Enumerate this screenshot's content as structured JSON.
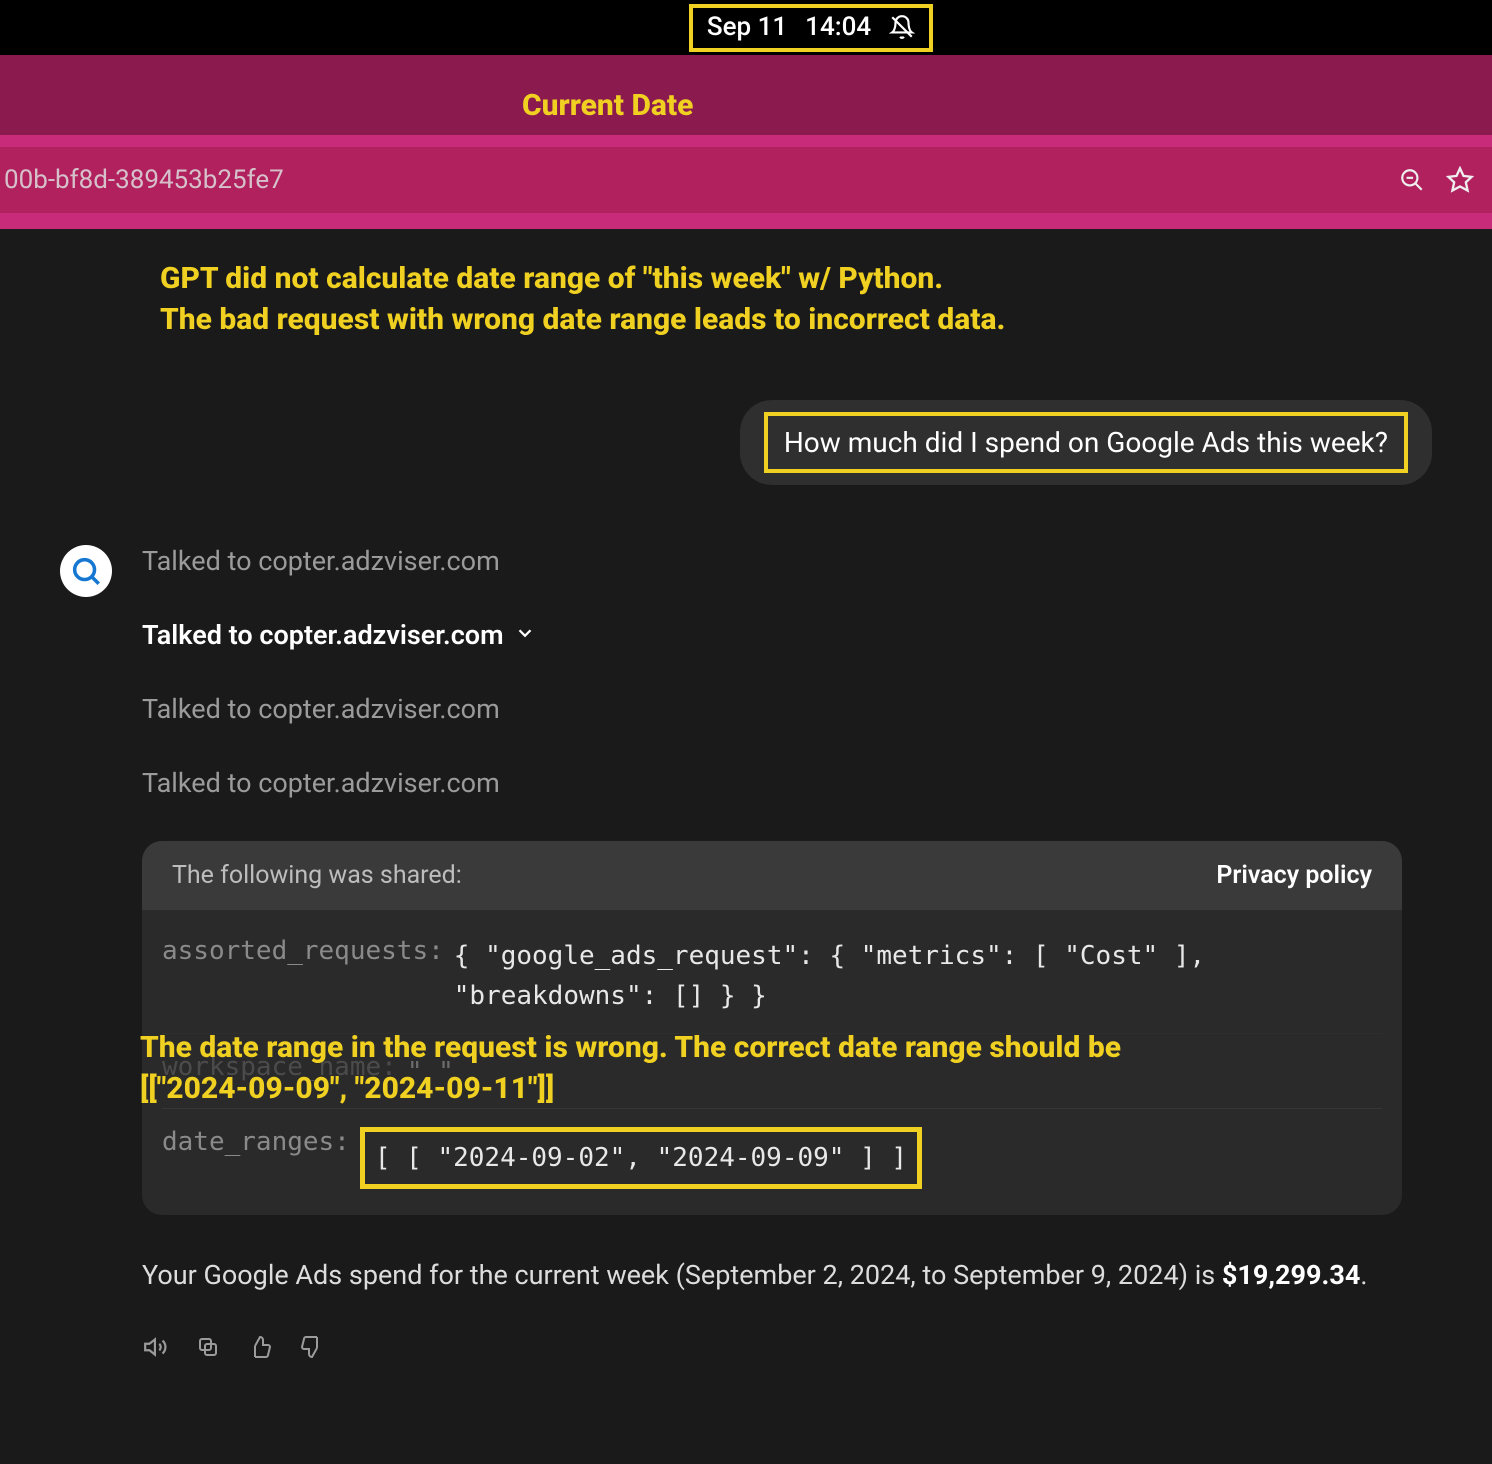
{
  "statusbar": {
    "date": "Sep 11",
    "time": "14:04"
  },
  "annotations": {
    "current_date": "Current Date",
    "headline_line1": "GPT did not calculate date range of \"this week\" w/ Python.",
    "headline_line2": "The bad request with wrong date range leads to incorrect data.",
    "wrong_line1": "The date range in the request is wrong. The correct date range should be",
    "wrong_line2": "[[\"2024-09-09\", \"2024-09-11\"]]"
  },
  "urlbar": {
    "fragment": "00b-bf8d-389453b25fe7"
  },
  "chat": {
    "user_message": "How much did I spend on Google Ads this week?",
    "talked": {
      "line1": "Talked to copter.adzviser.com",
      "line2_expanded": "Talked to copter.adzviser.com",
      "line3": "Talked to copter.adzviser.com",
      "line4": "Talked to copter.adzviser.com"
    },
    "shared": {
      "header": "The following was shared:",
      "privacy": "Privacy policy",
      "assorted_key": "assorted_requests:",
      "assorted_val": "{ \"google_ads_request\": { \"metrics\": [ \"Cost\" ], \"breakdowns\": [] } }",
      "workspace_key": "workspace_name:",
      "workspace_val": "\"   \"",
      "date_key": "date_ranges:",
      "date_val": "[ [ \"2024-09-02\", \"2024-09-09\" ] ]"
    },
    "final_prefix": "Your Google Ads spend for the current week (September 2, 2024, to September 9, 2024) is ",
    "final_amount": "$19,299.34",
    "final_suffix": "."
  }
}
